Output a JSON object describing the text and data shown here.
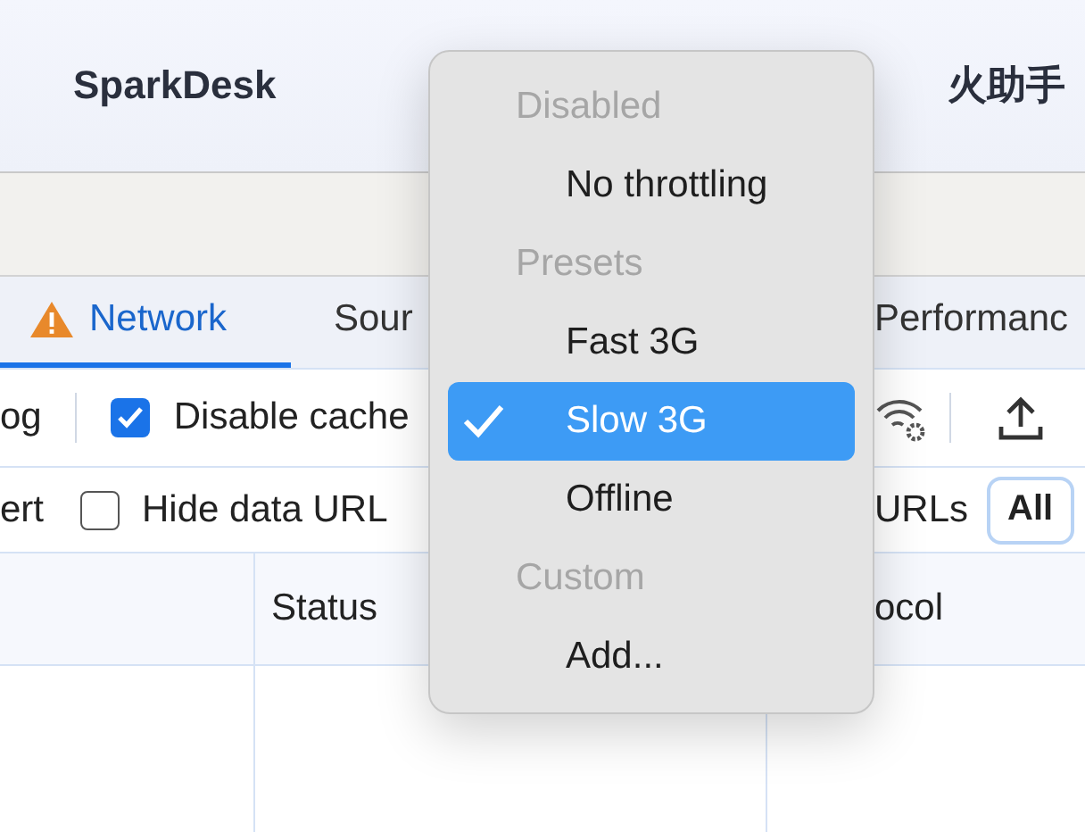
{
  "app_header": {
    "title": "SparkDesk",
    "title_2": "火助手"
  },
  "tabs": [
    {
      "label": "Network",
      "selected": true,
      "warning": true
    },
    {
      "label": "Sour",
      "selected": false
    },
    {
      "label": "Performanc",
      "selected": false
    }
  ],
  "toolbar": {
    "preserve_log_label": "og",
    "disable_cache": {
      "label": "Disable cache",
      "checked": true
    }
  },
  "filter_bar": {
    "invert_label": "ert",
    "hide_data_urls": {
      "label": "Hide data URL",
      "checked": false
    },
    "blocked_label": "URLs",
    "type_filters": [
      {
        "label": "All",
        "selected": true
      }
    ]
  },
  "table": {
    "columns": [
      "Status",
      "ocol"
    ]
  },
  "throttle_menu": {
    "items": [
      {
        "kind": "header",
        "label": "Disabled"
      },
      {
        "kind": "option",
        "label": "No throttling",
        "selected": false
      },
      {
        "kind": "header",
        "label": "Presets"
      },
      {
        "kind": "option",
        "label": "Fast 3G",
        "selected": false
      },
      {
        "kind": "option",
        "label": "Slow 3G",
        "selected": true
      },
      {
        "kind": "option",
        "label": "Offline",
        "selected": false
      },
      {
        "kind": "header",
        "label": "Custom"
      },
      {
        "kind": "option",
        "label": "Add...",
        "selected": false
      }
    ]
  }
}
